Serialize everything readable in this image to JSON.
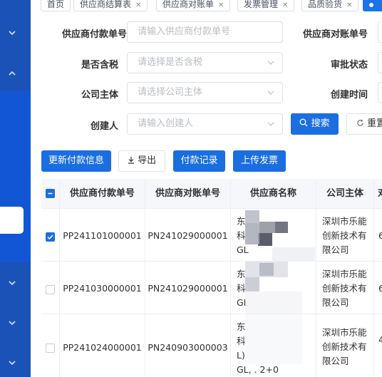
{
  "tabs": [
    {
      "label": "首页",
      "closable": false,
      "active": false
    },
    {
      "label": "供应商结算表",
      "closable": true,
      "active": false
    },
    {
      "label": "供应商对账单",
      "closable": true,
      "active": false
    },
    {
      "label": "发票管理",
      "closable": true,
      "active": false
    },
    {
      "label": "品质验货",
      "closable": true,
      "active": false
    },
    {
      "label": "",
      "closable": false,
      "active": true
    }
  ],
  "search": {
    "pay_no": {
      "label": "供应商付款单号",
      "placeholder": "请输入供应商付款单号"
    },
    "recon_no": {
      "label": "供应商对账单号"
    },
    "tax": {
      "label": "是否含税",
      "placeholder": "请选择是否含税"
    },
    "approval": {
      "label": "审批状态"
    },
    "company": {
      "label": "公司主体",
      "placeholder": "请选择公司主体"
    },
    "created_time": {
      "label": "创建时间"
    },
    "creator": {
      "label": "创建人",
      "placeholder": "请输入创建人"
    },
    "search_btn": "搜索",
    "reset_btn": "重置"
  },
  "toolbar": {
    "update": "更新付款信息",
    "export": "导出",
    "records": "付款记录",
    "upload": "上传发票"
  },
  "table": {
    "headers": [
      "供应商付款单号",
      "供应商对账单号",
      "供应商名称",
      "公司主体",
      "对"
    ],
    "rows": [
      {
        "checked": true,
        "pay_no": "PP241101000001",
        "recon_no": "PN241029000001",
        "supplier": [
          "东",
          "科",
          "GL"
        ],
        "company": [
          "深圳市乐能",
          "创新技术有",
          "限公司"
        ],
        "extra": "6"
      },
      {
        "checked": false,
        "pay_no": "PP241030000001",
        "recon_no": "PN241029000001",
        "supplier": [
          "东",
          "科",
          "GL"
        ],
        "company": [
          "深圳市乐能",
          "创新技术有",
          "限公司"
        ],
        "extra": "6"
      },
      {
        "checked": false,
        "pay_no": "PP241024000001",
        "recon_no": "PN240903000003",
        "supplier": [
          "东",
          "科",
          "L)",
          "GL, . 2+0"
        ],
        "company": [
          "深圳市乐能",
          "创新技术有",
          "限公司"
        ],
        "extra": "4"
      }
    ]
  },
  "colors": {
    "primary": "#1a6ee0",
    "sidebar": "#1b52b8",
    "sidebar_active": "#1256d6"
  }
}
